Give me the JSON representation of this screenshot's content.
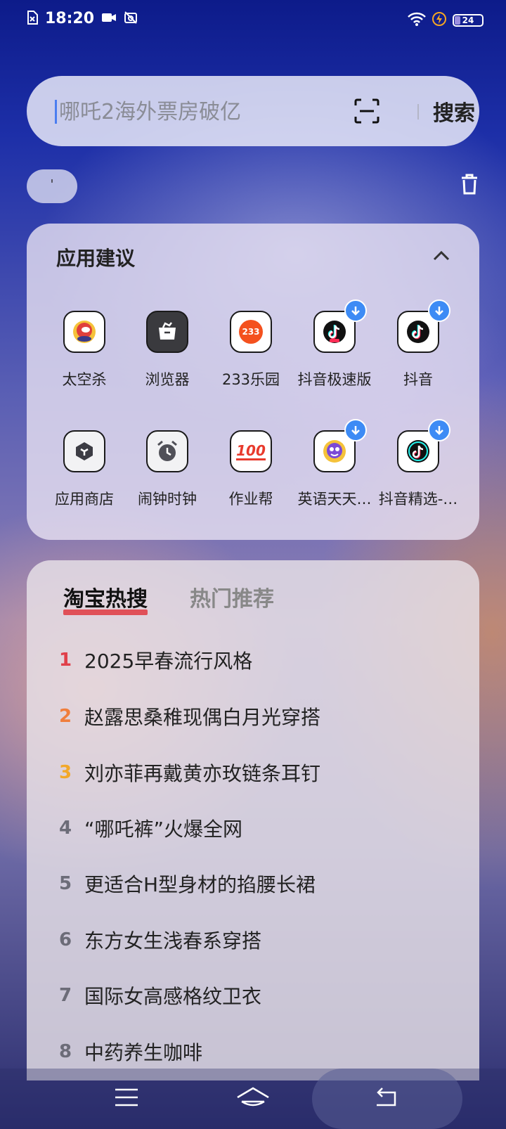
{
  "status_bar": {
    "time": "18:20",
    "battery": "24",
    "battery_level_percent": 24
  },
  "search": {
    "placeholder": "哪吒2海外票房破亿",
    "button_label": "搜索"
  },
  "history": {
    "chip_label": "'"
  },
  "app_suggestions": {
    "title": "应用建议",
    "apps": [
      {
        "label": "太空杀",
        "icon": "space-kill-icon",
        "download": false
      },
      {
        "label": "浏览器",
        "icon": "browser-icon",
        "download": false
      },
      {
        "label": "233乐园",
        "icon": "233-icon",
        "icon_text": "233",
        "download": false
      },
      {
        "label": "抖音极速版",
        "icon": "douyin-lite-icon",
        "download": true
      },
      {
        "label": "抖音",
        "icon": "douyin-icon",
        "download": true
      },
      {
        "label": "应用商店",
        "icon": "app-store-icon",
        "download": false
      },
      {
        "label": "闹钟时钟",
        "icon": "alarm-clock-icon",
        "download": false
      },
      {
        "label": "作业帮",
        "icon": "zuoyebang-icon",
        "icon_text": "100",
        "download": false
      },
      {
        "label": "英语天天…",
        "icon": "english-daily-icon",
        "download": true
      },
      {
        "label": "抖音精选-…",
        "icon": "douyin-featured-icon",
        "download": true
      }
    ]
  },
  "hot_search": {
    "tabs": [
      "淘宝热搜",
      "热门推荐"
    ],
    "active_tab": 0,
    "rank_colors": [
      "#e0404a",
      "#f07e3c",
      "#f2a82a",
      "#6c6c78"
    ],
    "items": [
      {
        "rank": "1",
        "text": "2025早春流行风格"
      },
      {
        "rank": "2",
        "text": "赵露思桑稚现偶白月光穿搭"
      },
      {
        "rank": "3",
        "text": "刘亦菲再戴黄亦玫链条耳钉"
      },
      {
        "rank": "4",
        "text": "“哪吒裤”火爆全网"
      },
      {
        "rank": "5",
        "text": "更适合H型身材的掐腰长裙"
      },
      {
        "rank": "6",
        "text": "东方女生浅春系穿搭"
      },
      {
        "rank": "7",
        "text": "国际女高感格纹卫衣"
      },
      {
        "rank": "8",
        "text": "中药养生咖啡"
      }
    ]
  }
}
